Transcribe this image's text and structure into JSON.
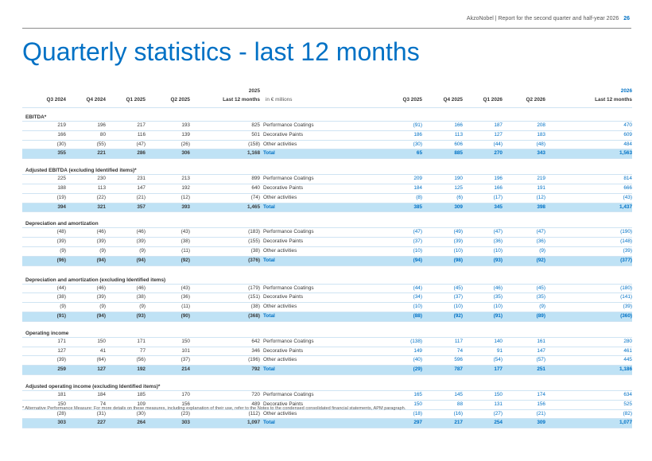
{
  "header": {
    "text": "AkzoNobel | Report for the second quarter and half-year 2026",
    "page": "26"
  },
  "title": "Quarterly statistics - last 12 months",
  "years": {
    "left": "2025",
    "right": "2026"
  },
  "columns": {
    "q3_2024": "Q3 2024",
    "q4_2024": "Q4 2024",
    "q1_2025": "Q1 2025",
    "q2_2025": "Q2 2025",
    "ltm": "Last 12 months",
    "unit": "in € millions",
    "q3_2025": "Q3 2025",
    "q4_2025": "Q4 2025",
    "q1_2026": "Q1 2026",
    "q2_2026": "Q2 2026",
    "ltm2": "Last 12 months"
  },
  "sections": [
    {
      "title": "EBITDA*",
      "rows": [
        {
          "v": [
            "219",
            "196",
            "217",
            "193",
            "825"
          ],
          "label": "Performance Coatings",
          "w": [
            "(91)",
            "166",
            "187",
            "208",
            "470"
          ]
        },
        {
          "v": [
            "166",
            "80",
            "116",
            "139",
            "501"
          ],
          "label": "Decorative Paints",
          "w": [
            "186",
            "113",
            "127",
            "183",
            "609"
          ]
        },
        {
          "v": [
            "(30)",
            "(55)",
            "(47)",
            "(26)",
            "(158)"
          ],
          "label": "Other activities",
          "w": [
            "(30)",
            "606",
            "(44)",
            "(48)",
            "484"
          ]
        },
        {
          "v": [
            "355",
            "221",
            "286",
            "306",
            "1,168"
          ],
          "label": "Total",
          "w": [
            "65",
            "885",
            "270",
            "343",
            "1,563"
          ],
          "total": true
        }
      ]
    },
    {
      "title": "Adjusted EBITDA (excluding Identified items)*",
      "rows": [
        {
          "v": [
            "225",
            "230",
            "231",
            "213",
            "899"
          ],
          "label": "Performance Coatings",
          "w": [
            "209",
            "190",
            "196",
            "219",
            "814"
          ]
        },
        {
          "v": [
            "188",
            "113",
            "147",
            "192",
            "640"
          ],
          "label": "Decorative Paints",
          "w": [
            "184",
            "125",
            "166",
            "191",
            "666"
          ]
        },
        {
          "v": [
            "(19)",
            "(22)",
            "(21)",
            "(12)",
            "(74)"
          ],
          "label": "Other activities",
          "w": [
            "(8)",
            "(6)",
            "(17)",
            "(12)",
            "(43)"
          ]
        },
        {
          "v": [
            "394",
            "321",
            "357",
            "393",
            "1,465"
          ],
          "label": "Total",
          "w": [
            "385",
            "309",
            "345",
            "398",
            "1,437"
          ],
          "total": true
        }
      ]
    },
    {
      "title": "Depreciation and amortization",
      "rows": [
        {
          "v": [
            "(48)",
            "(46)",
            "(46)",
            "(43)",
            "(183)"
          ],
          "label": "Performance Coatings",
          "w": [
            "(47)",
            "(49)",
            "(47)",
            "(47)",
            "(190)"
          ]
        },
        {
          "v": [
            "(39)",
            "(39)",
            "(39)",
            "(38)",
            "(155)"
          ],
          "label": "Decorative Paints",
          "w": [
            "(37)",
            "(39)",
            "(36)",
            "(36)",
            "(148)"
          ]
        },
        {
          "v": [
            "(9)",
            "(9)",
            "(9)",
            "(11)",
            "(38)"
          ],
          "label": "Other activities",
          "w": [
            "(10)",
            "(10)",
            "(10)",
            "(9)",
            "(39)"
          ]
        },
        {
          "v": [
            "(96)",
            "(94)",
            "(94)",
            "(92)",
            "(376)"
          ],
          "label": "Total",
          "w": [
            "(94)",
            "(98)",
            "(93)",
            "(92)",
            "(377)"
          ],
          "total": true
        }
      ]
    },
    {
      "title": "Depreciation and amortization (excluding Identified items)",
      "rows": [
        {
          "v": [
            "(44)",
            "(46)",
            "(46)",
            "(43)",
            "(179)"
          ],
          "label": "Performance Coatings",
          "w": [
            "(44)",
            "(45)",
            "(46)",
            "(45)",
            "(180)"
          ]
        },
        {
          "v": [
            "(38)",
            "(39)",
            "(38)",
            "(36)",
            "(151)"
          ],
          "label": "Decorative Paints",
          "w": [
            "(34)",
            "(37)",
            "(35)",
            "(35)",
            "(141)"
          ]
        },
        {
          "v": [
            "(9)",
            "(9)",
            "(9)",
            "(11)",
            "(38)"
          ],
          "label": "Other activities",
          "w": [
            "(10)",
            "(10)",
            "(10)",
            "(9)",
            "(39)"
          ]
        },
        {
          "v": [
            "(91)",
            "(94)",
            "(93)",
            "(90)",
            "(368)"
          ],
          "label": "Total",
          "w": [
            "(88)",
            "(92)",
            "(91)",
            "(89)",
            "(360)"
          ],
          "total": true
        }
      ]
    },
    {
      "title": "Operating income",
      "rows": [
        {
          "v": [
            "171",
            "150",
            "171",
            "150",
            "642"
          ],
          "label": "Performance Coatings",
          "w": [
            "(138)",
            "117",
            "140",
            "161",
            "280"
          ]
        },
        {
          "v": [
            "127",
            "41",
            "77",
            "101",
            "346"
          ],
          "label": "Decorative Paints",
          "w": [
            "149",
            "74",
            "91",
            "147",
            "461"
          ]
        },
        {
          "v": [
            "(39)",
            "(64)",
            "(56)",
            "(37)",
            "(196)"
          ],
          "label": "Other activities",
          "w": [
            "(40)",
            "596",
            "(54)",
            "(57)",
            "445"
          ]
        },
        {
          "v": [
            "259",
            "127",
            "192",
            "214",
            "792"
          ],
          "label": "Total",
          "w": [
            "(29)",
            "787",
            "177",
            "251",
            "1,186"
          ],
          "total": true
        }
      ]
    },
    {
      "title": "Adjusted operating income (excluding Identified items)*",
      "rows": [
        {
          "v": [
            "181",
            "184",
            "185",
            "170",
            "720"
          ],
          "label": "Performance Coatings",
          "w": [
            "165",
            "145",
            "150",
            "174",
            "634"
          ]
        },
        {
          "v": [
            "150",
            "74",
            "109",
            "156",
            "489"
          ],
          "label": "Decorative Paints",
          "w": [
            "150",
            "88",
            "131",
            "156",
            "525"
          ]
        },
        {
          "v": [
            "(28)",
            "(31)",
            "(30)",
            "(23)",
            "(112)"
          ],
          "label": "Other activities",
          "w": [
            "(18)",
            "(16)",
            "(27)",
            "(21)",
            "(82)"
          ]
        },
        {
          "v": [
            "303",
            "227",
            "264",
            "303",
            "1,097"
          ],
          "label": "Total",
          "w": [
            "297",
            "217",
            "254",
            "309",
            "1,077"
          ],
          "total": true
        }
      ]
    }
  ],
  "footnote": "* Alternative Performance Measure: For more details on these measures, including explanation of their use, refer to the Notes to the condensed consolidated financial statements, APM paragraph."
}
